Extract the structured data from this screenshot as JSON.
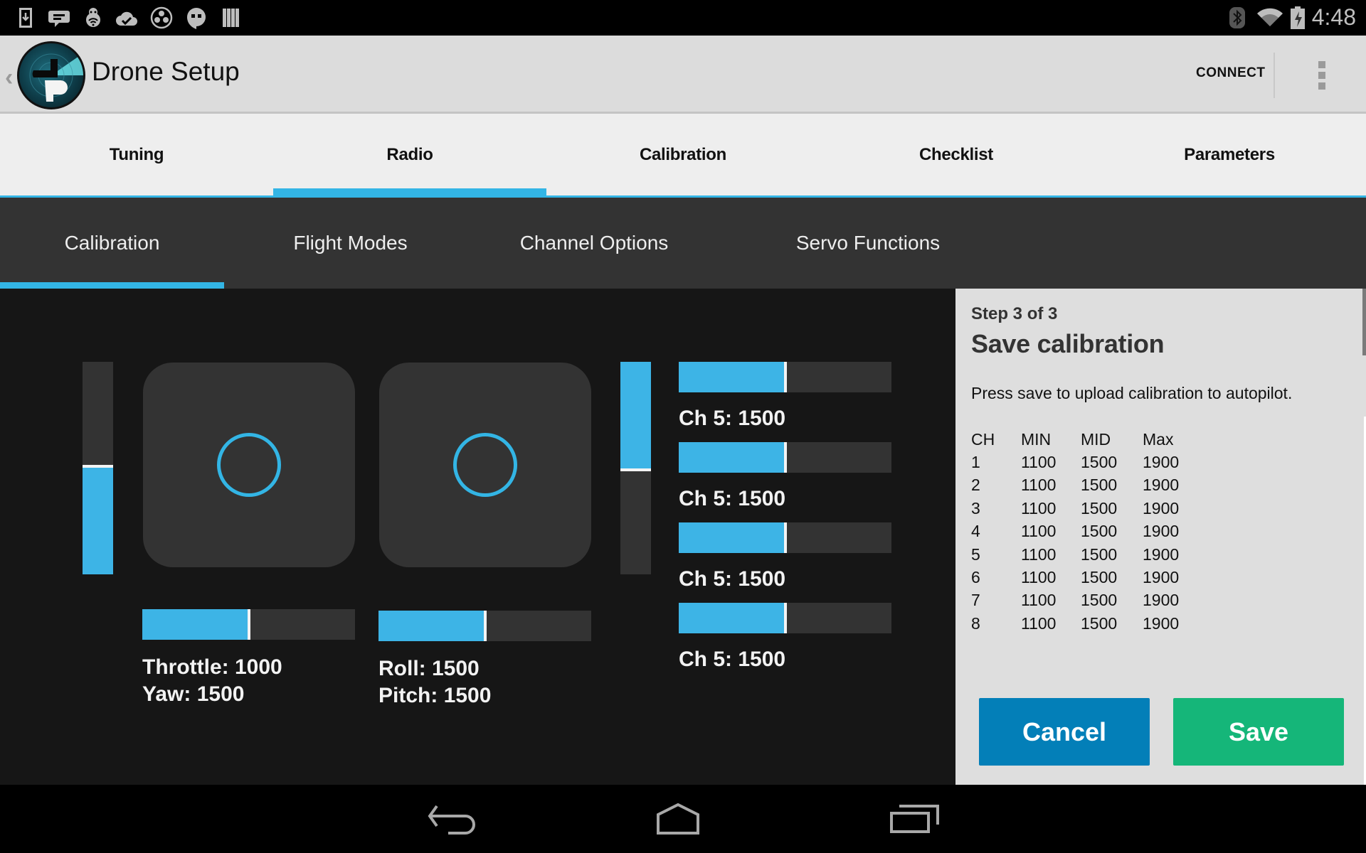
{
  "status_bar": {
    "left_icons": [
      "download-icon",
      "message-icon",
      "debug-bug-icon",
      "cloud-check-icon",
      "circles-app-icon",
      "hangouts-icon",
      "barcode-icon"
    ],
    "right_icons": [
      "bluetooth-icon",
      "wifi-icon",
      "battery-charging-icon"
    ],
    "time": "4:48"
  },
  "action_bar": {
    "title": "Drone Setup",
    "connect_label": "CONNECT"
  },
  "top_tabs": [
    {
      "label": "Tuning",
      "active": false
    },
    {
      "label": "Radio",
      "active": true
    },
    {
      "label": "Calibration",
      "active": false
    },
    {
      "label": "Checklist",
      "active": false
    },
    {
      "label": "Parameters",
      "active": false
    }
  ],
  "sub_tabs": [
    {
      "label": "Calibration",
      "active": true
    },
    {
      "label": "Flight Modes",
      "active": false
    },
    {
      "label": "Channel Options",
      "active": false
    },
    {
      "label": "Servo Functions",
      "active": false
    }
  ],
  "radio": {
    "accent_color": "#33b5e5",
    "range": [
      1000,
      2000
    ],
    "left_vertical_bar": {
      "fill_fraction": 0.5,
      "direction": "bottom-up"
    },
    "right_vertical_bar": {
      "fill_fraction": 0.5,
      "direction": "top-down"
    },
    "left_stick": {
      "x": 0.5,
      "y": 0.5
    },
    "right_stick": {
      "x": 0.5,
      "y": 0.5
    },
    "left_hbar": {
      "fill_fraction": 0.5
    },
    "right_hbar": {
      "fill_fraction": 0.5
    },
    "left_labels": {
      "line1": "Throttle: 1000",
      "line2": "Yaw: 1500"
    },
    "right_labels": {
      "line1": "Roll: 1500",
      "line2": "Pitch: 1500"
    },
    "channels": [
      {
        "label": "Ch 5: 1500",
        "fill_fraction": 0.5
      },
      {
        "label": "Ch 5: 1500",
        "fill_fraction": 0.5
      },
      {
        "label": "Ch 5: 1500",
        "fill_fraction": 0.5
      },
      {
        "label": "Ch 5: 1500",
        "fill_fraction": 0.5
      }
    ]
  },
  "panel": {
    "step": "Step 3 of 3",
    "title": "Save calibration",
    "description": "Press save to upload calibration to autopilot.",
    "table": {
      "headers": [
        "CH",
        "MIN",
        "MID",
        "Max"
      ],
      "rows": [
        [
          "1",
          "1100",
          "1500",
          "1900"
        ],
        [
          "2",
          "1100",
          "1500",
          "1900"
        ],
        [
          "3",
          "1100",
          "1500",
          "1900"
        ],
        [
          "4",
          "1100",
          "1500",
          "1900"
        ],
        [
          "5",
          "1100",
          "1500",
          "1900"
        ],
        [
          "6",
          "1100",
          "1500",
          "1900"
        ],
        [
          "7",
          "1100",
          "1500",
          "1900"
        ],
        [
          "8",
          "1100",
          "1500",
          "1900"
        ]
      ]
    },
    "cancel_label": "Cancel",
    "save_label": "Save",
    "cancel_color": "#037fb8",
    "save_color": "#15b679"
  },
  "nav_bar": {
    "buttons": [
      "back-icon",
      "home-icon",
      "recents-icon"
    ]
  }
}
